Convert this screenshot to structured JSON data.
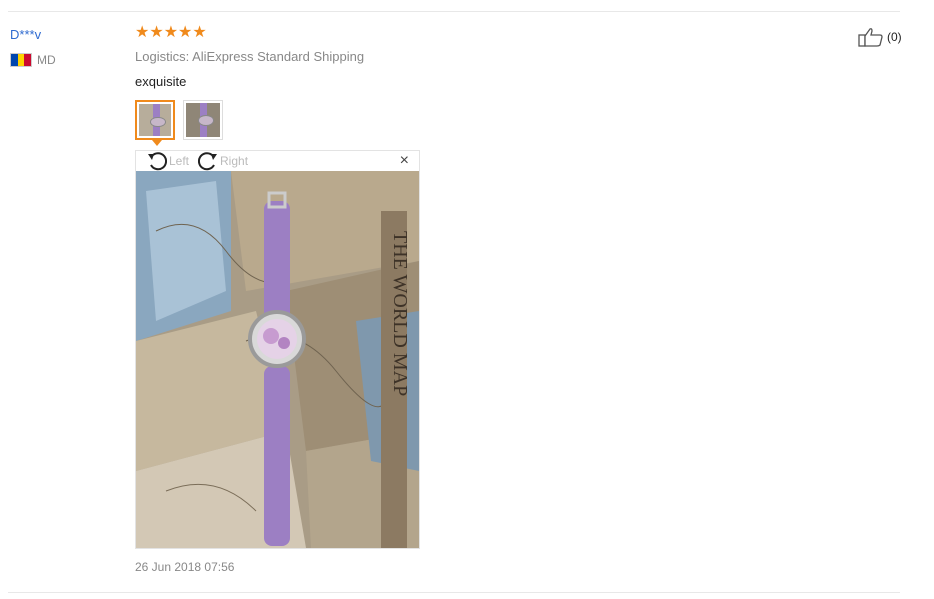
{
  "review": {
    "user_name": "D***v",
    "country_code": "MD",
    "flag_colors": [
      "#0046ae",
      "#ffd200",
      "#cc092f"
    ],
    "rating_stars": 5,
    "star_glyphs": "★★★★★",
    "logistics": "Logistics: AliExpress Standard Shipping",
    "comment": "exquisite",
    "rotate_left_label": "Left",
    "rotate_right_label": "Right",
    "close_glyph": "×",
    "photo_caption": "THE WORLD MAP",
    "date": "26 Jun 2018 07:56",
    "helpful_count": "(0)"
  },
  "colors": {
    "star": "#f08a1c",
    "link": "#2e6ad0",
    "muted": "#888888",
    "strap": "#9c7fc3"
  }
}
